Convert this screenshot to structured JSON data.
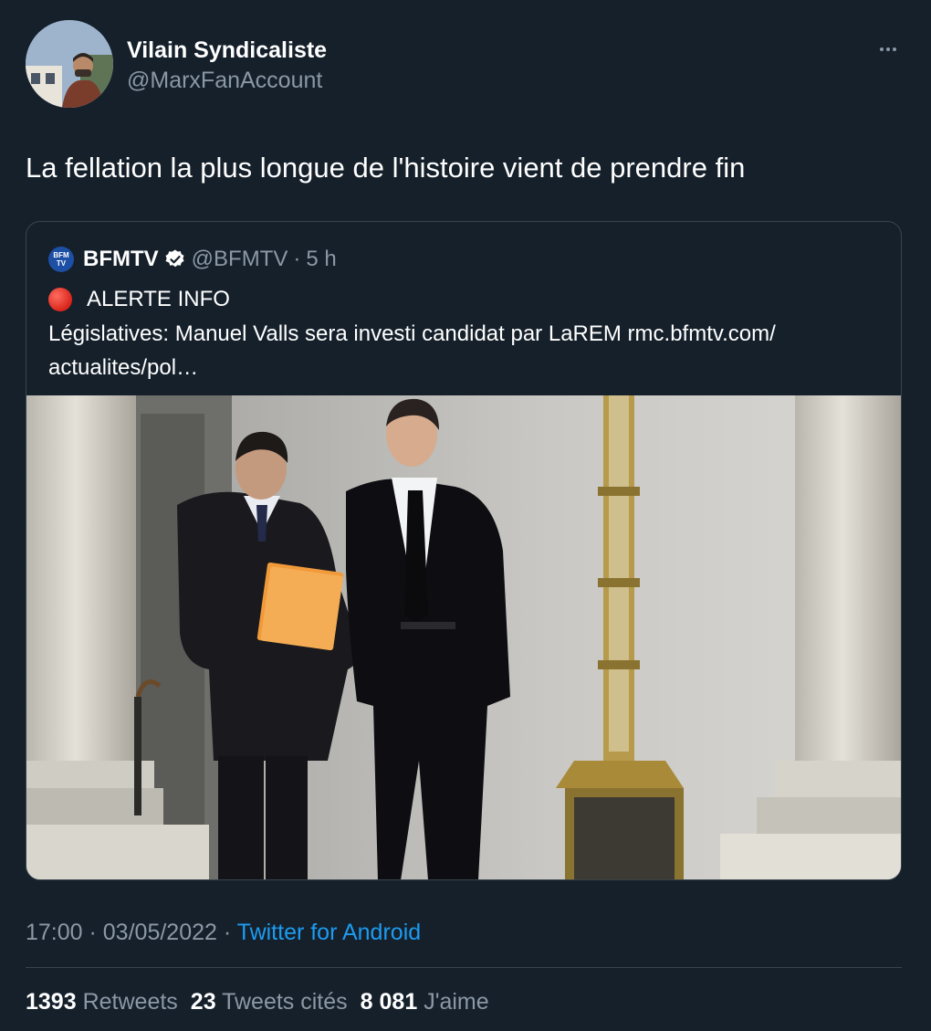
{
  "tweet": {
    "author": {
      "display_name": "Vilain Syndicaliste",
      "handle": "@MarxFanAccount",
      "avatar_icon": "profile-photo"
    },
    "more_icon": "more-dots-icon",
    "text": "La fellation la plus longue de l'histoire vient de prendre fin",
    "quoted": {
      "logo_text": "BFM TV",
      "display_name": "BFMTV",
      "verified": true,
      "handle": "@BFMTV",
      "separator": "·",
      "time": "5 h",
      "alert_icon": "red-circle-emoji",
      "alert_text": "ALERTE INFO",
      "body": "Législatives: Manuel Valls sera investi candidat par LaREM rmc.bfmtv.com/ actualites/pol…",
      "media": "photo-two-men-in-dark-suits-between-stone-columns"
    },
    "meta": {
      "time": "17:00",
      "separator1": " · ",
      "date": "03/05/2022",
      "separator2": " · ",
      "source": "Twitter for Android"
    },
    "stats": {
      "retweets_count": "1393",
      "retweets_label": "Retweets",
      "quotes_count": "23",
      "quotes_label": "Tweets cités",
      "likes_count": "8 081",
      "likes_label": "J'aime"
    }
  },
  "colors": {
    "background": "#15202b",
    "text": "#ffffff",
    "secondary": "#8b98a5",
    "link": "#1d9bf0",
    "border": "#38444d"
  }
}
